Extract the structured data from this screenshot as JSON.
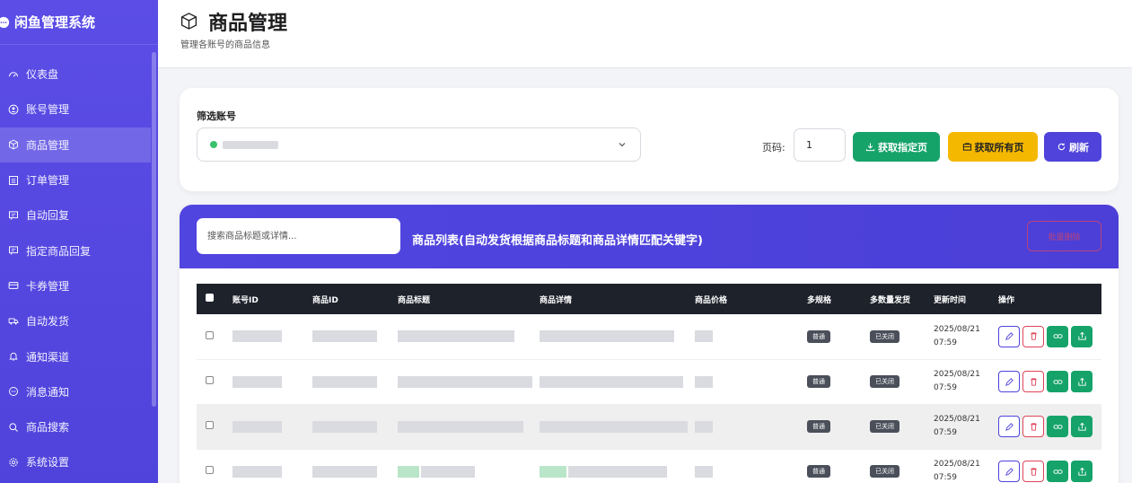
{
  "app": {
    "title": "闲鱼管理系统"
  },
  "sidebar": {
    "items": [
      {
        "label": "仪表盘",
        "icon": "dashboard-icon"
      },
      {
        "label": "账号管理",
        "icon": "user-circle-icon"
      },
      {
        "label": "商品管理",
        "icon": "box-icon",
        "active": true
      },
      {
        "label": "订单管理",
        "icon": "list-icon"
      },
      {
        "label": "自动回复",
        "icon": "message-icon"
      },
      {
        "label": "指定商品回复",
        "icon": "message-icon"
      },
      {
        "label": "卡券管理",
        "icon": "card-icon"
      },
      {
        "label": "自动发货",
        "icon": "truck-icon"
      },
      {
        "label": "通知渠道",
        "icon": "bell-icon"
      },
      {
        "label": "消息通知",
        "icon": "chat-icon"
      },
      {
        "label": "商品搜索",
        "icon": "search-icon"
      },
      {
        "label": "系统设置",
        "icon": "gear-icon"
      }
    ]
  },
  "header": {
    "title": "商品管理",
    "subtitle": "管理各账号的商品信息"
  },
  "filter": {
    "label": "筛选账号",
    "page_label": "页码:",
    "page_value": "1",
    "btn_fetch_page": "获取指定页",
    "btn_fetch_all": "获取所有页",
    "btn_refresh": "刷新"
  },
  "list": {
    "search_placeholder": "搜索商品标题或详情...",
    "title": "商品列表(自动发货根据商品标题和商品详情匹配关键字)",
    "batch_delete": "批量删除",
    "columns": [
      "账号ID",
      "商品ID",
      "商品标题",
      "商品详情",
      "商品价格",
      "多规格",
      "多数量发货",
      "更新时间",
      "操作"
    ],
    "rows": [
      {
        "spec": "普通",
        "multi": "已关闭",
        "date": "2025/08/21",
        "time": "07:59"
      },
      {
        "spec": "普通",
        "multi": "已关闭",
        "date": "2025/08/21",
        "time": "07:59"
      },
      {
        "spec": "普通",
        "multi": "已关闭",
        "date": "2025/08/21",
        "time": "07:59"
      },
      {
        "spec": "普通",
        "multi": "已关闭",
        "date": "2025/08/21",
        "time": "07:59"
      }
    ]
  },
  "colors": {
    "sidebar": "#5b4de6",
    "accent": "#4f43db",
    "green": "#16a36a",
    "yellow": "#f5b800",
    "danger": "#e0445a"
  }
}
